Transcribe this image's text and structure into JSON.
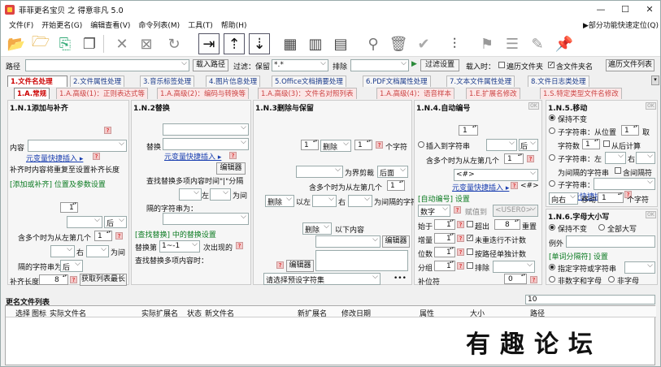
{
  "window": {
    "title": "菲菲更名宝贝 之 得意非凡 5.0",
    "minimize": "—",
    "maximize": "☐",
    "close": "✕"
  },
  "menu": {
    "items": [
      "文件(F)",
      "开始更名(G)",
      "编辑查看(V)",
      "命令列表(M)",
      "工具(T)",
      "帮助(H)"
    ],
    "right": "▶部分功能快速定位(Q)"
  },
  "toolbar": {
    "icons": [
      "open-folder-icon",
      "add-folder-icon",
      "import-icon",
      "copy-icon",
      "delete-icon",
      "clear-icon",
      "refresh-icon",
      "move-right-icon",
      "move-up-icon",
      "move-down-icon",
      "grid-icon",
      "table-icon",
      "info-card-icon",
      "search-icon",
      "trash-icon",
      "check-icon",
      "sliders-icon",
      "flag-icon",
      "list-icon",
      "edit-list-icon",
      "pin-icon"
    ]
  },
  "pathrow": {
    "path_label": "路径",
    "load_path": "载入路径",
    "filter_label": "过滤：保留",
    "filter_value": "*.*",
    "exclude_label": "排除",
    "filter_settings": "过滤设置",
    "load_when": "载入时：",
    "traverse_folders": "遍历文件夹",
    "include_folder_names": "含文件夹名",
    "traverse_list": "遍历文件列表"
  },
  "tabs1": [
    "1.文件名处理",
    "2.文件属性处理",
    "3.音乐标签处理",
    "4.图片信息处理",
    "5.Office文档摘要处理",
    "6.PDF文档属性处理",
    "7.文本文件属性处理",
    "8.文件日志类处理"
  ],
  "tabs2": [
    "1.A.常规",
    "1.A.高级(1)：正则表达式等",
    "1.A.高级(2)：编码与转换等",
    "1.A.高级(3)：文件名对照列表",
    "1.A.高级(4)：语音样本",
    "1.E.扩展名修改",
    "1.S.特定类型文件名修改"
  ],
  "p1": {
    "title": "1.N.1添加与补齐",
    "content": "内容",
    "varins": "元变量快捷插入 ▸",
    "note": "补齐时内容将重复至设置补齐长度",
    "sub": "[添加或补齐] 位置及参数设置",
    "spin1": "1",
    "after": "后",
    "nth_label": "含多个时为从左第几个",
    "spin2": "1",
    "right": "右",
    "between": "为间",
    "sep_label": "隔的字符串为",
    "pos": "后",
    "padlen_label": "补齐长度",
    "padlen": "8",
    "getmax": "获取列表最长"
  },
  "p2": {
    "title": "1.N.2替换",
    "replace": "替换",
    "varins": "元变量快捷插入 ▸",
    "editor": "编辑器",
    "find_note": "查找替换多项内容时间\"|\"分隔",
    "left": "左",
    "between": "为间",
    "sep_label": "隔的字符串为：",
    "sub": "[查找替换] 中的替换设置",
    "nth_label": "替换第",
    "nth_val": "1~-1",
    "nth_tail": "次出现的",
    "find_note2": "查找替换多项内容时："
  },
  "p3": {
    "title": "1.N.3删除与保留",
    "spin1": "1",
    "delete": "删除",
    "spin2": "1",
    "chars": "个字符",
    "boundary": "为界剪裁",
    "after": "后面",
    "nth_label": "含多个时为从左第几个",
    "spin3": "1",
    "delete2": "删除",
    "from_left": "以左",
    "right": "右",
    "between_str": "为间隔的字符串",
    "delete3": "删除",
    "below": "以下内容",
    "editor": "编辑器",
    "editor2": "编辑器",
    "preset": "请选择预设字符集"
  },
  "p4": {
    "title": "1.N.4.自动编号",
    "spin1": "1",
    "insert_to": "插入到字符串",
    "after": "后",
    "nth_label": "含多个时为从左第几个",
    "spin2": "1",
    "field": "<#>",
    "varins": "元变量快捷插入 ▸",
    "tag": "<#>",
    "sub": "[自动编号] 设置",
    "numtype": "数字",
    "fillzero": "赋值到",
    "userdef": "<USER0>",
    "start_label": "始于",
    "start": "1",
    "exceed": "超出",
    "exceed_val": "8",
    "repeat": "重置",
    "inc_label": "增量",
    "inc": "1",
    "no_dup": "未重迭行不计数",
    "digits_label": "位数",
    "digits": "1",
    "per_dir": "按路径单独计数",
    "group_label": "分组",
    "group": "1",
    "exclude": "排除",
    "pad_label": "补位符",
    "pad": "0"
  },
  "p5": {
    "title": "1.N.5.移动",
    "keep": "保持不变",
    "sub_from": "子字符串：从位置",
    "spin1": "1",
    "take": "取",
    "chars_label": "字符数",
    "spin2": "1",
    "post_calc": "从后计算",
    "sub_left": "子字符串：左",
    "right": "右",
    "sep_label": "为间隔的字符串",
    "include_sep": "含间隔符",
    "sub_str": "子字符串：",
    "varins": "元变量快捷插入 ▸",
    "dir": "向右",
    "move": "移动",
    "spin3": "1",
    "chars": "个字符"
  },
  "p6": {
    "title": "1.N.6.字母大小写",
    "keep": "保持不变",
    "all_upper": "全部大写",
    "except": "例外",
    "sub": "[单词分隔符] 设置",
    "spec": "指定字符或字符串",
    "nonalnum": "非数字和字母",
    "nonletter": "非字母"
  },
  "list": {
    "title": "更名文件列表",
    "count": "10",
    "columns": [
      "选择",
      "图标",
      "实际文件名",
      "实际扩展名",
      "状态",
      "新文件名",
      "新扩展名",
      "修改日期",
      "属性",
      "大小",
      "路径"
    ]
  },
  "watermark": "有趣论坛"
}
